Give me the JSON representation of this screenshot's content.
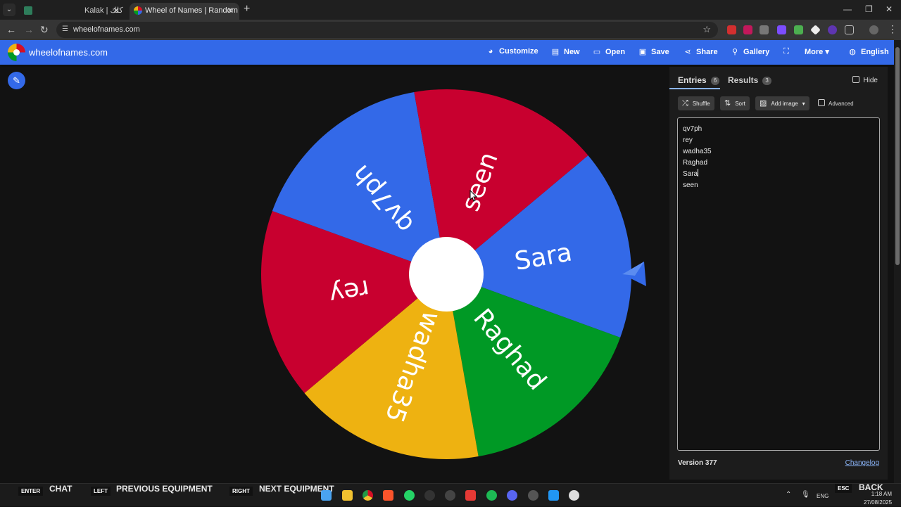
{
  "browser": {
    "tabs": [
      {
        "title": "Kalak | كلك",
        "favicon_color": "#2e7d5b"
      },
      {
        "title": "Wheel of Names | Random nam",
        "favicon_color": "#3369e8"
      }
    ],
    "url": "wheelofnames.com"
  },
  "header": {
    "brand": "wheelofnames.com",
    "nav": [
      {
        "label": "Customize",
        "icon": "palette-icon"
      },
      {
        "label": "New",
        "icon": "file-icon"
      },
      {
        "label": "Open",
        "icon": "folder-icon"
      },
      {
        "label": "Save",
        "icon": "save-icon"
      },
      {
        "label": "Share",
        "icon": "share-icon"
      },
      {
        "label": "Gallery",
        "icon": "search-icon"
      },
      {
        "label": "More",
        "icon": "chevron-down-icon"
      },
      {
        "label": "English",
        "icon": "globe-icon"
      }
    ]
  },
  "wheel": {
    "pointer_color": "#3369e8",
    "segments": [
      {
        "label": "Sara",
        "color": "#3369e8"
      },
      {
        "label": "Raghad",
        "color": "#009925"
      },
      {
        "label": "wadha35",
        "color": "#eeb211"
      },
      {
        "label": "rey",
        "color": "#c8002f"
      },
      {
        "label": "qv7ph",
        "color": "#3369e8"
      },
      {
        "label": "seen",
        "color": "#c8002f"
      }
    ]
  },
  "panel": {
    "entries_tab": "Entries",
    "entries_count": "6",
    "results_tab": "Results",
    "results_count": "3",
    "hide_label": "Hide",
    "buttons": {
      "shuffle": "Shuffle",
      "sort": "Sort",
      "add_image": "Add image"
    },
    "advanced_label": "Advanced",
    "entries": [
      "qv7ph",
      "rey",
      "wadha35",
      "Raghad",
      "Sara",
      "seen"
    ],
    "version": "Version 377",
    "changelog": "Changelog"
  },
  "taskbar": {
    "hints": [
      {
        "key": "ENTER",
        "label": "CHAT"
      },
      {
        "key": "LEFT",
        "label": "PREVIOUS EQUIPMENT"
      },
      {
        "key": "RIGHT",
        "label": "NEXT EQUIPMENT"
      }
    ],
    "esc_key": "ESC",
    "back_label": "BACK",
    "lang": "ENG",
    "time": "1:18 AM",
    "date": "27/08/2025"
  }
}
